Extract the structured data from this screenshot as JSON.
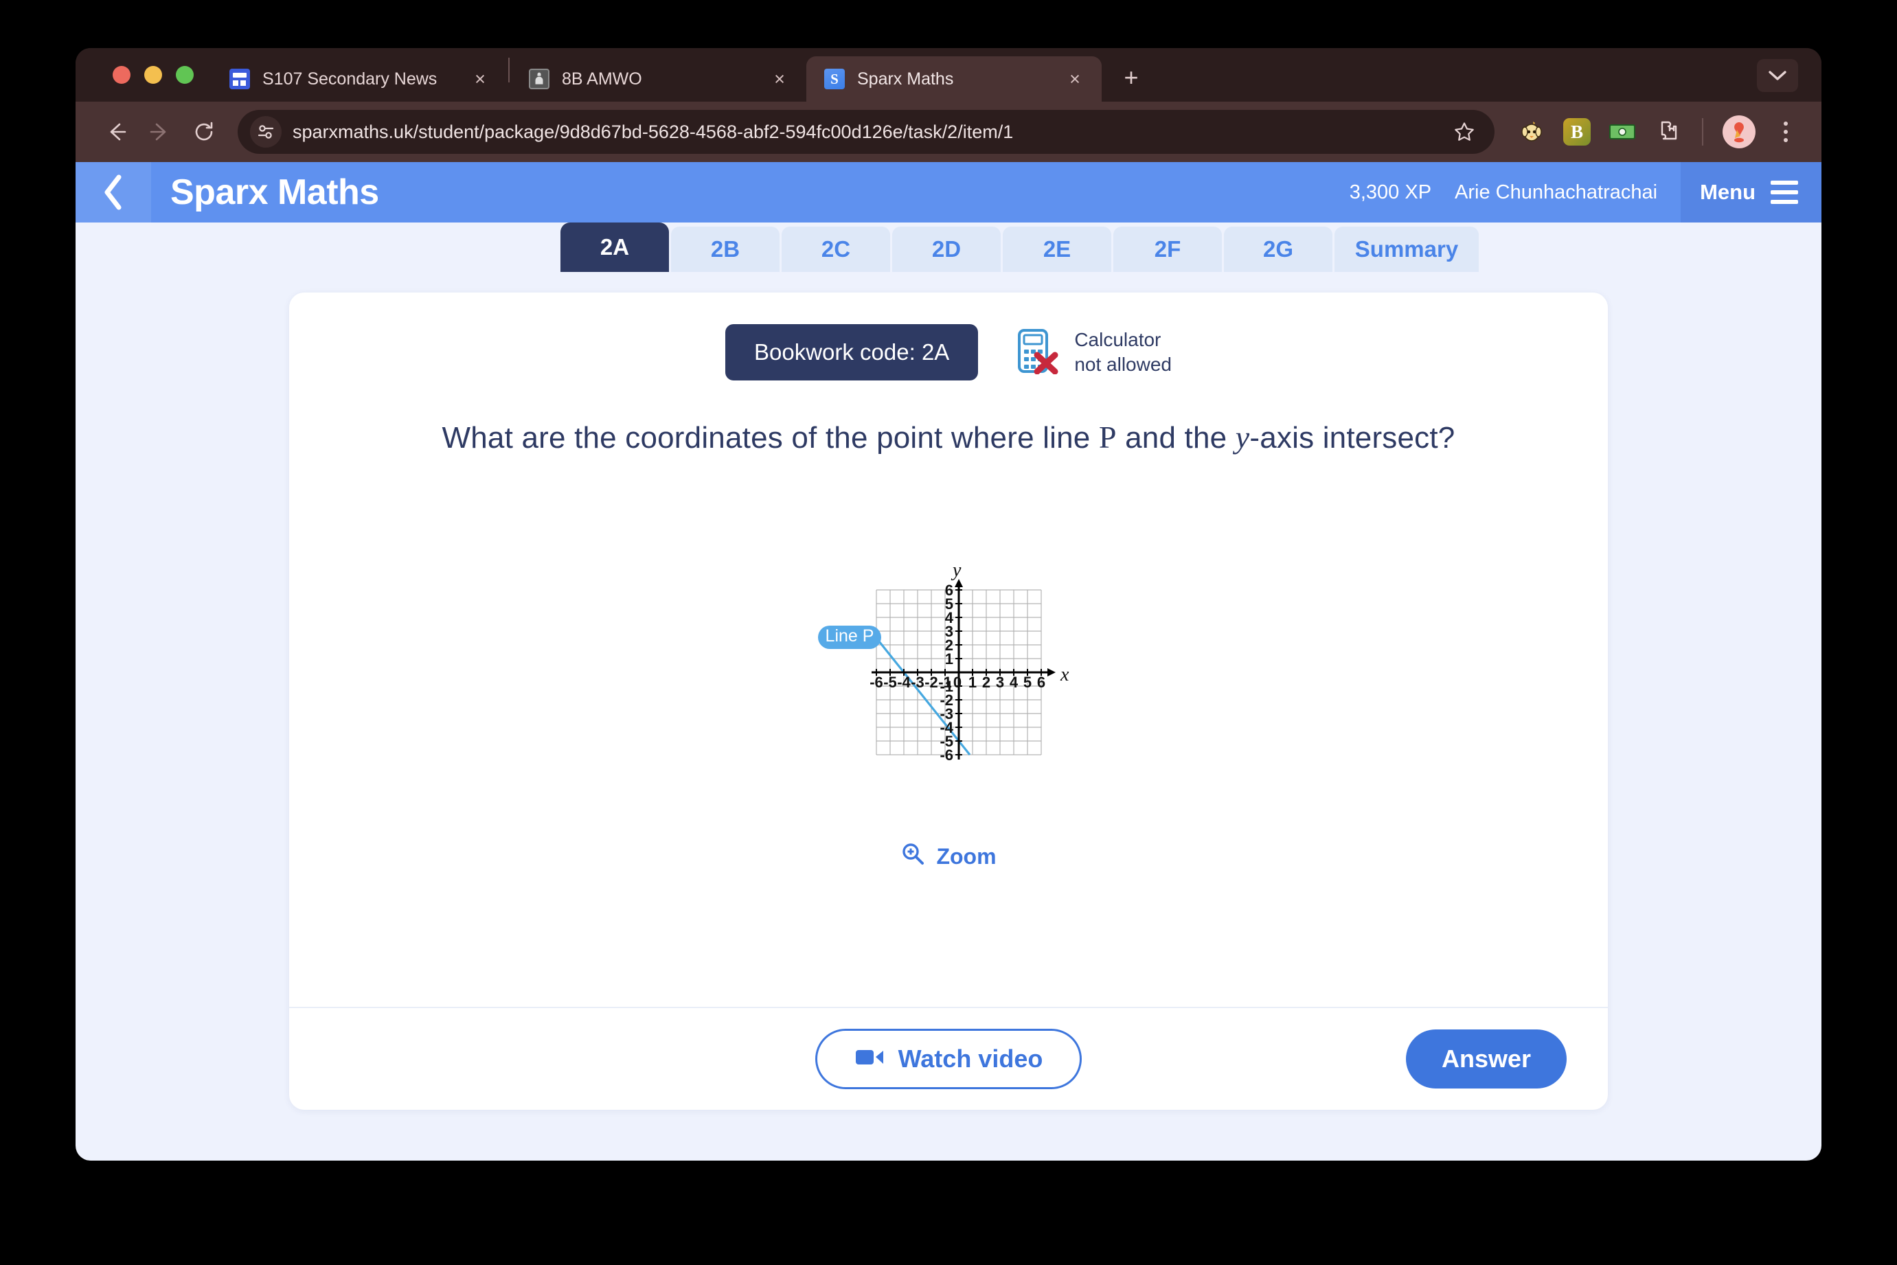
{
  "browser": {
    "tabs": [
      {
        "title": "S107 Secondary News",
        "favicon": "news-grid-icon",
        "active": false,
        "close_label": "×"
      },
      {
        "title": "8B AMWO",
        "favicon": "person-frame-icon",
        "active": false,
        "close_label": "×"
      },
      {
        "title": "Sparx Maths",
        "favicon": "sparx-s-icon",
        "favicon_letter": "S",
        "active": true,
        "close_label": "×"
      }
    ],
    "new_tab_label": "+",
    "window_chevron": "chevron-down-icon",
    "url": "sparxmaths.uk/student/package/9d8d67bd-5628-4568-abf2-594fc00d126e/task/2/item/1",
    "nav": {
      "back": "back-arrow-icon",
      "forward": "forward-arrow-icon",
      "reload": "reload-icon"
    },
    "site_settings_icon": "tune-sliders-icon",
    "bookmark_icon": "star-outline-icon",
    "extensions": [
      "chicken-avatar-icon",
      "B",
      "money-note-icon",
      "puzzle-piece-icon"
    ],
    "profile_icon": "maps-pin-avatar-icon",
    "menu_icon": "kebab-menu-icon"
  },
  "app": {
    "back_icon": "chevron-left-icon",
    "title": "Sparx Maths",
    "xp": "3,300 XP",
    "user": "Arie Chunhachatrachai",
    "menu_label": "Menu",
    "menu_icon": "hamburger-icon"
  },
  "task_tabs": [
    {
      "label": "2A",
      "active": true
    },
    {
      "label": "2B",
      "active": false
    },
    {
      "label": "2C",
      "active": false
    },
    {
      "label": "2D",
      "active": false
    },
    {
      "label": "2E",
      "active": false
    },
    {
      "label": "2F",
      "active": false
    },
    {
      "label": "2G",
      "active": false
    },
    {
      "label": "Summary",
      "active": false
    }
  ],
  "question_card": {
    "bookwork_code": "Bookwork code: 2A",
    "calculator_icon": "calculator-not-allowed-icon",
    "calculator_line1": "Calculator",
    "calculator_line2": "not allowed",
    "question_prefix": "What are the coordinates of the point where line ",
    "question_var_line": "P",
    "question_middle": " and the ",
    "question_var_axis": "y",
    "question_suffix": "-axis intersect?",
    "zoom_label": "Zoom",
    "zoom_icon": "magnifier-plus-icon",
    "watch_video_label": "Watch video",
    "watch_video_icon": "video-camera-icon",
    "answer_label": "Answer"
  },
  "chart_data": {
    "type": "line",
    "title": "",
    "xlabel": "x",
    "ylabel": "y",
    "xlim": [
      -6,
      6
    ],
    "ylim": [
      -6,
      6
    ],
    "xticks": [
      -6,
      -5,
      -4,
      -3,
      -2,
      -1,
      0,
      1,
      2,
      3,
      4,
      5,
      6
    ],
    "yticks": [
      -6,
      -5,
      -4,
      -3,
      -2,
      -1,
      1,
      2,
      3,
      4,
      5,
      6
    ],
    "xtick_labels": [
      "-6",
      "-5",
      "-4",
      "-3",
      "-2",
      "-1",
      "0",
      "1",
      "2",
      "3",
      "4",
      "5",
      "6"
    ],
    "ytick_labels": [
      "-6",
      "-5",
      "-4",
      "-3",
      "-2",
      "-1",
      "1",
      "2",
      "3",
      "4",
      "5",
      "6"
    ],
    "grid": true,
    "grid_color": "#b3b3b3",
    "axis_color": "#000000",
    "line_color": "#46a8e0",
    "series": [
      {
        "name": "Line P",
        "label": "Line P",
        "label_position": "left-outside",
        "equation": "y = -1.25x - 5",
        "slope": -1.25,
        "y_intercept": -5,
        "x_intercept": -4,
        "points": [
          [
            -6,
            2.5
          ],
          [
            -4,
            0
          ],
          [
            0,
            -5
          ],
          [
            0.8,
            -6
          ]
        ]
      }
    ],
    "legend_position": "none"
  },
  "colors": {
    "accent_blue": "#3e76dd",
    "header_blue": "#5f91ef",
    "navy": "#2e3a63",
    "line_blue": "#46a8e0",
    "badge_blue": "#56aae8",
    "page_bg": "#eef2fd",
    "browser_chrome": "#2c1d1d"
  }
}
